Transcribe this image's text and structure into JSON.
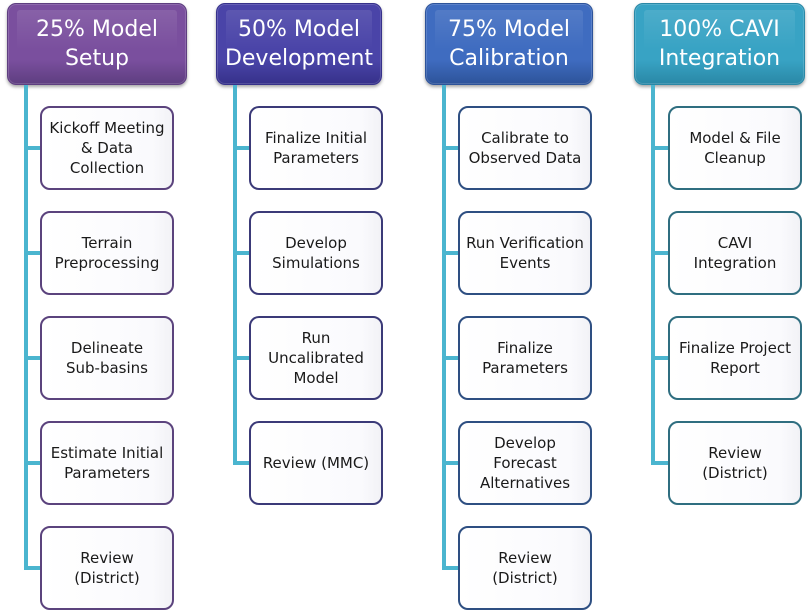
{
  "diagram": {
    "columns": [
      {
        "title": "25% Model\nSetup",
        "color": "#7a4f9e",
        "border": "#5e3e80",
        "child_border": "#5b437d",
        "tasks": [
          "Kickoff Meeting\n& Data\nCollection",
          "Terrain\nPreprocessing",
          "Delineate\nSub-basins",
          "Estimate Initial\nParameters",
          "Review\n(District)"
        ]
      },
      {
        "title": "50% Model\nDevelopment",
        "color": "#4a44a8",
        "border": "#36318a",
        "child_border": "#3b3a78",
        "tasks": [
          "Finalize Initial\nParameters",
          "Develop\nSimulations",
          "Run\nUncalibrated\nModel",
          "Review (MMC)"
        ]
      },
      {
        "title": "75% Model\nCalibration",
        "color": "#3f6cc0",
        "border": "#2d539a",
        "child_border": "#2e4f82",
        "tasks": [
          "Calibrate to\nObserved Data",
          "Run Verification\nEvents",
          "Finalize\nParameters",
          "Develop\nForecast\nAlternatives",
          "Review\n(District)"
        ]
      },
      {
        "title": "100% CAVI\nIntegration",
        "color": "#38a3c4",
        "border": "#2a88a6",
        "child_border": "#2f6e80",
        "tasks": [
          "Model & File\nCleanup",
          "CAVI\nIntegration",
          "Finalize Project\nReport",
          "Review\n(District)"
        ]
      }
    ],
    "connector_color": "#4bb5cf"
  }
}
